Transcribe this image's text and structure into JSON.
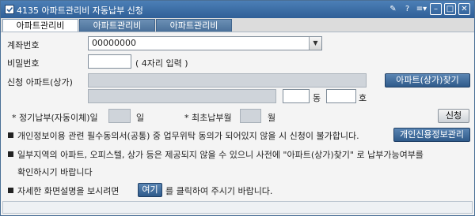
{
  "window": {
    "title": "4135 아파트관리비 자동납부 신청",
    "icons": [
      "pin-icon",
      "help-icon",
      "menu-icon",
      "minimize-icon",
      "restore-icon",
      "close-icon"
    ],
    "icon_glyphs": {
      "pin": "✎",
      "help": "?",
      "menu": "≡▾",
      "minimize": "–",
      "restore": "□",
      "close": "✕"
    }
  },
  "tabs": [
    {
      "label": "아파트관리비",
      "active": true
    },
    {
      "label": "아파트관리비",
      "active": false
    },
    {
      "label": "아파트관리비",
      "active": false
    }
  ],
  "form": {
    "account_label": "계좌번호",
    "account_value": "00000000",
    "password_label": "비밀번호",
    "password_value": "",
    "password_hint": "( 4자리 입력 )",
    "apartment_label": "신청 아파트(상가)",
    "apartment_value": "",
    "apartment_address": "",
    "search_button": "아파트(상가)찾기",
    "dong_value": "",
    "dong_label": "동",
    "ho_value": "",
    "ho_label": "호",
    "payday_label": "* 정기납부(자동이체)일",
    "payday_value": "",
    "payday_unit": "일",
    "first_month_label": "* 최초납부월",
    "first_month_value": "",
    "first_month_unit": "월",
    "apply_button": "신청"
  },
  "notices": {
    "privacy_text": "개인정보이용 관련 필수동의서(공통) 중 업무위탁 동의가 되어있지 않을 시 신청이 불가합니다.",
    "privacy_button": "개인신용정보관리",
    "region_line1": "일부지역의 아파트, 오피스텔, 상가 등은 제공되지 않을 수 있으니 사전에 \"아파트(상가)찾기\" 로 납부가능여부를",
    "region_line2": "확인하시기 바랍니다",
    "help_prefix": "자세한 화면설명을 보시려면",
    "help_button": "여기",
    "help_suffix": "를 클릭하여 주시기 바랍니다."
  },
  "colors": {
    "titlebar": "#2f5f97",
    "button": "#2f5a8a",
    "readonly_field": "#cfd4da"
  }
}
